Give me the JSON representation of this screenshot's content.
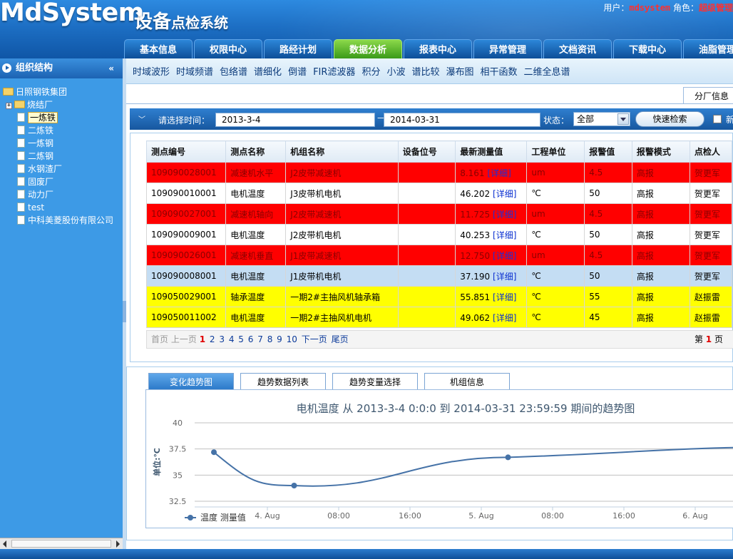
{
  "header": {
    "logo": "MdSystem",
    "subtitle_big": "设备",
    "subtitle_small": "点检系统",
    "user_label": "用户：",
    "user_value": "mdsystem",
    "role_label": " 角色：",
    "role_value": "超级管理"
  },
  "main_nav": [
    "基本信息",
    "权限中心",
    "路经计划",
    "数据分析",
    "报表中心",
    "异常管理",
    "文档资讯",
    "下载中心",
    "油脂管理"
  ],
  "main_nav_active": "数据分析",
  "sidebar": {
    "title": "组织结构",
    "collapse_glyph": "«",
    "root": "日照钢铁集团",
    "group": "烧结厂",
    "selected": "一炼铁",
    "items": [
      "二炼铁",
      "一炼钢",
      "二炼钢",
      "水钢渣厂",
      "固废厂",
      "动力厂",
      "test",
      "中科美菱股份有限公司"
    ]
  },
  "sub_nav": [
    "时域波形",
    "时域频谱",
    "包络谱",
    "谱细化",
    "倒谱",
    "FIR滤波器",
    "积分",
    "小波",
    "谱比较",
    "瀑布图",
    "相干函数",
    "二维全息谱"
  ],
  "right_tab": "分厂信息",
  "search": {
    "time_label": "请选择时间：",
    "start": "2013-3-4",
    "dash": "—",
    "end": "2014-03-31",
    "status_label": "状态：",
    "status_value": "全部",
    "button": "快速检索",
    "new_label": "新"
  },
  "table": {
    "headers": [
      "测点编号",
      "测点名称",
      "机组名称",
      "设备位号",
      "最新测量值",
      "工程单位",
      "报警值",
      "报警模式",
      "点检人"
    ],
    "rows": [
      {
        "style": "red",
        "id": "109090028001",
        "name": "减速机水平",
        "unit_name": "J2皮带减速机",
        "pos": "",
        "value": "8.161",
        "detail": "[详细]",
        "eng": "um",
        "alarm": "4.5",
        "mode": "高报",
        "person": "贺更军"
      },
      {
        "style": "white",
        "id": "109090010001",
        "name": "电机温度",
        "unit_name": "J3皮带机电机",
        "pos": "",
        "value": "46.202",
        "detail": "[详细]",
        "eng": "℃",
        "alarm": "50",
        "mode": "高报",
        "person": "贺更军"
      },
      {
        "style": "red",
        "id": "109090027001",
        "name": "减速机轴向",
        "unit_name": "J2皮带减速机",
        "pos": "",
        "value": "11.725",
        "detail": "[详细]",
        "eng": "um",
        "alarm": "4.5",
        "mode": "高报",
        "person": "贺更军"
      },
      {
        "style": "white",
        "id": "109090009001",
        "name": "电机温度",
        "unit_name": "J2皮带机电机",
        "pos": "",
        "value": "40.253",
        "detail": "[详细]",
        "eng": "℃",
        "alarm": "50",
        "mode": "高报",
        "person": "贺更军"
      },
      {
        "style": "red",
        "id": "109090026001",
        "name": "减速机垂直",
        "unit_name": "J1皮带减速机",
        "pos": "",
        "value": "12.750",
        "detail": "[详细]",
        "eng": "um",
        "alarm": "4.5",
        "mode": "高报",
        "person": "贺更军"
      },
      {
        "style": "blue",
        "id": "109090008001",
        "name": "电机温度",
        "unit_name": "J1皮带机电机",
        "pos": "",
        "value": "37.190",
        "detail": "[详细]",
        "eng": "℃",
        "alarm": "50",
        "mode": "高报",
        "person": "贺更军"
      },
      {
        "style": "yellow",
        "id": "109050029001",
        "name": "轴承温度",
        "unit_name": "一期2#主抽风机轴承箱",
        "pos": "",
        "value": "55.851",
        "detail": "[详细]",
        "eng": "℃",
        "alarm": "55",
        "mode": "高报",
        "person": "赵振雷"
      },
      {
        "style": "yellow",
        "id": "109050011002",
        "name": "电机温度",
        "unit_name": "一期2#主抽风机电机",
        "pos": "",
        "value": "49.062",
        "detail": "[详细]",
        "eng": "℃",
        "alarm": "45",
        "mode": "高报",
        "person": "赵振雷"
      }
    ]
  },
  "pager": {
    "first": "首页",
    "prev": "上一页",
    "current": "1",
    "pages": [
      "2",
      "3",
      "4",
      "5",
      "6",
      "7",
      "8",
      "9",
      "10"
    ],
    "next": "下一页",
    "last": "尾页",
    "info_prefix": "第",
    "info_page": "1",
    "info_suffix": "页"
  },
  "chart_tabs": [
    "变化趋势图",
    "趋势数据列表",
    "趋势变量选择",
    "机组信息"
  ],
  "chart_tab_active": "变化趋势图",
  "chart_data": {
    "type": "line",
    "title": "电机温度 从 2013-3-4 0:0:0 到 2014-03-31 23:59:59 期间的趋势图",
    "ylabel": "单位:℃",
    "ylim": [
      32.5,
      40
    ],
    "yticks": [
      "40",
      "37.5",
      "35",
      "32.5"
    ],
    "xticks": [
      "4. Aug",
      "08:00",
      "16:00",
      "5. Aug",
      "08:00",
      "16:00",
      "6. Aug"
    ],
    "series": [
      {
        "name": "温度 测量值",
        "color": "#4572a7",
        "x": [
          "3. Aug 18:00",
          "4. Aug 03:00",
          "5. Aug 03:00",
          "6. Aug 12:00"
        ],
        "values": [
          37.19,
          34.0,
          36.7,
          37.7
        ]
      }
    ],
    "legend": "bottom-left",
    "grid": true
  }
}
